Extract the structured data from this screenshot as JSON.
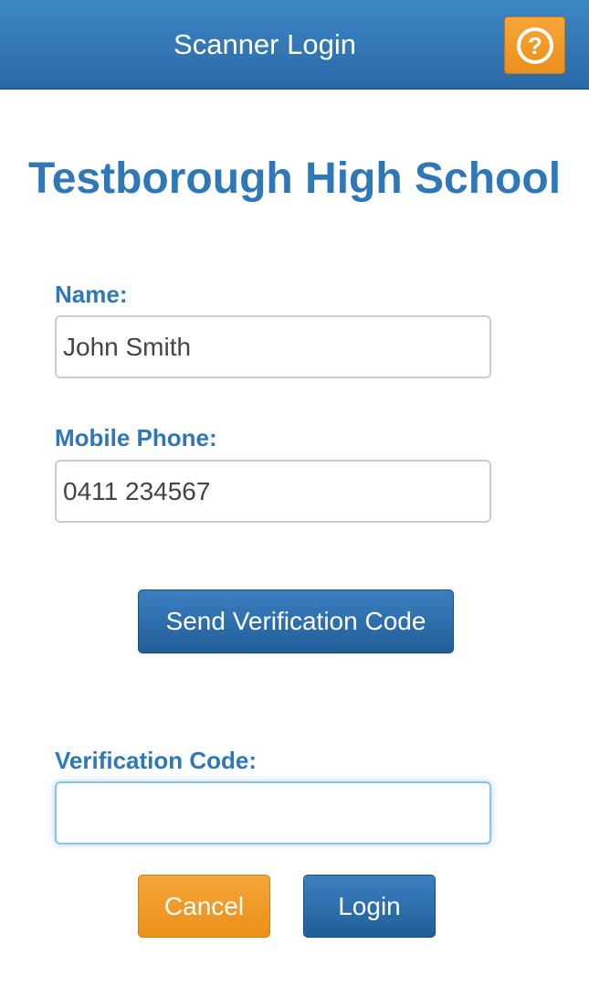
{
  "header": {
    "title": "Scanner Login",
    "help_icon": "question-circle-icon",
    "help_symbol": "?"
  },
  "school": {
    "name": "Testborough High School"
  },
  "form": {
    "name_label": "Name:",
    "name_value": "John Smith",
    "phone_label": "Mobile Phone:",
    "phone_value": "0411 234567",
    "send_code_label": "Send Verification Code",
    "code_label": "Verification Code:",
    "code_value": "",
    "cancel_label": "Cancel",
    "login_label": "Login"
  },
  "colors": {
    "header_blue": "#2e72b0",
    "accent_blue": "#2e77b8",
    "button_orange": "#ef9a26"
  }
}
